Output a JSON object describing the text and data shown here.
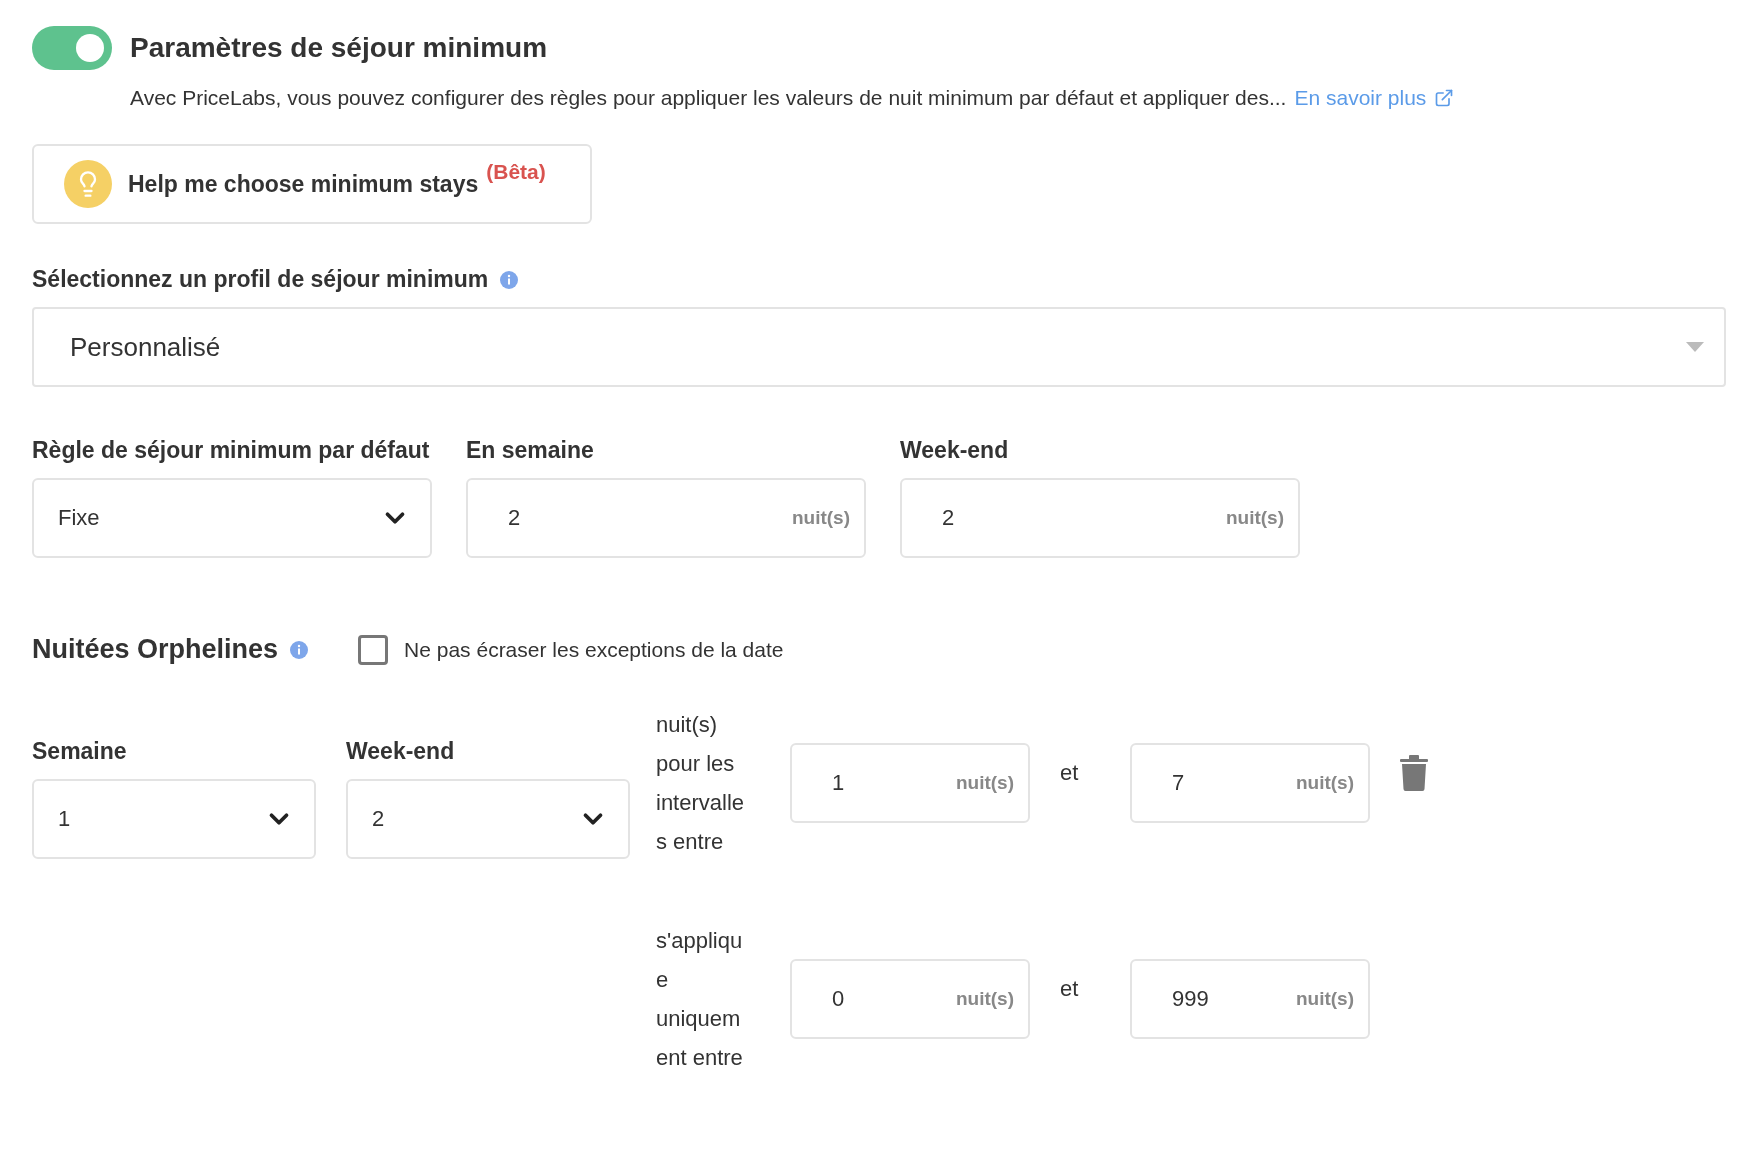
{
  "header": {
    "toggle": {
      "on": true
    },
    "title": "Paramètres de séjour minimum",
    "description": "Avec PriceLabs, vous pouvez configurer des règles pour appliquer les valeurs de nuit minimum par défaut et appliquer des...",
    "link": "En savoir plus"
  },
  "helper_button": {
    "label": "Help me choose minimum stays",
    "badge": "(Bêta)"
  },
  "profile": {
    "label": "Sélectionnez un profil de séjour minimum",
    "value": "Personnalisé"
  },
  "default_rule": [
    {
      "kind": "select",
      "label": "Règle de séjour minimum par défaut",
      "value": "Fixe"
    },
    {
      "kind": "number",
      "label": "En semaine",
      "value": "2",
      "unit": "nuit(s)"
    },
    {
      "kind": "number",
      "label": "Week-end",
      "value": "2",
      "unit": "nuit(s)"
    }
  ],
  "orphan_nights": {
    "title": "Nuitées Orphelines",
    "checkbox": {
      "label": "Ne pas écraser les exceptions de la date",
      "checked": false
    },
    "selects": [
      {
        "label": "Semaine",
        "value": "1"
      },
      {
        "label": "Week-end",
        "value": "2"
      }
    ],
    "ranges": [
      {
        "text": "nuit(s) pour les intervalles entre",
        "from": "1",
        "from_unit": "nuit(s)",
        "conjunction": "et",
        "to": "7",
        "to_unit": "nuit(s)",
        "deletable": true
      },
      {
        "text": "s'applique uniquement entre",
        "from": "0",
        "from_unit": "nuit(s)",
        "conjunction": "et",
        "to": "999",
        "to_unit": "nuit(s)",
        "deletable": false
      }
    ]
  }
}
